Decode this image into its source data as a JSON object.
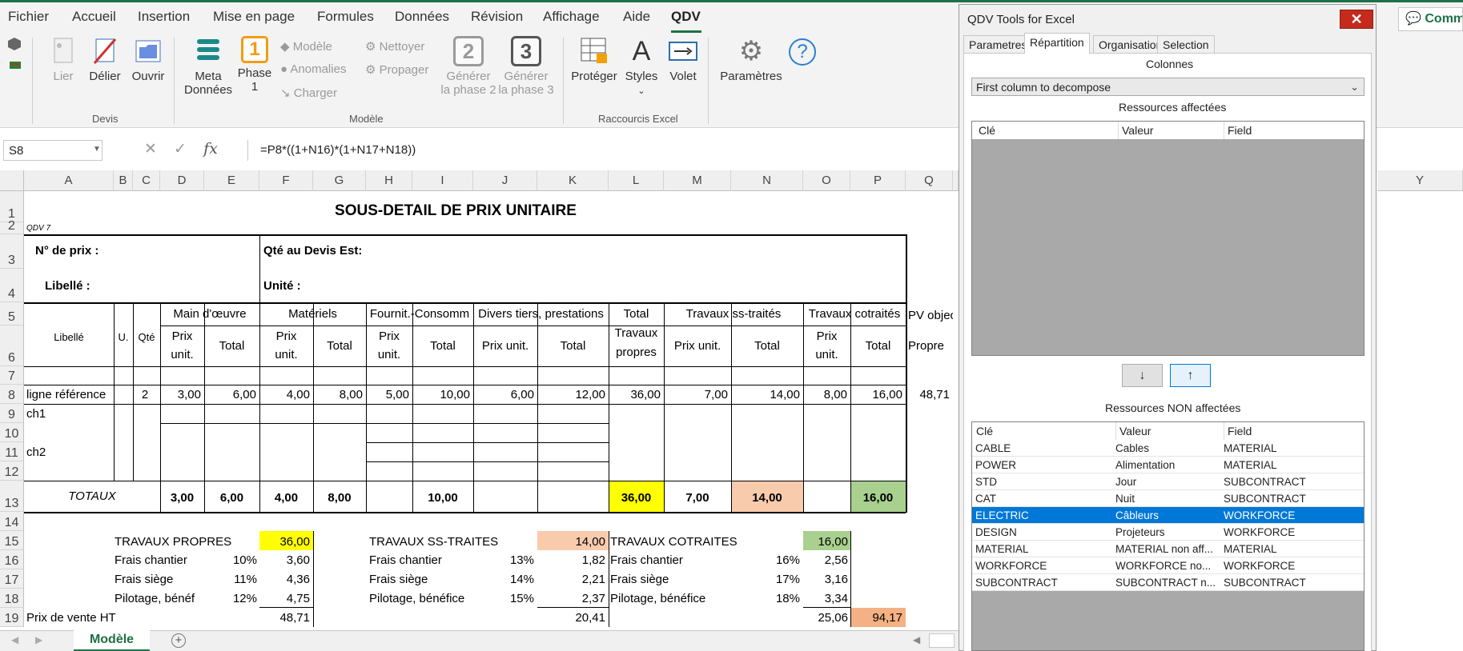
{
  "menu": [
    "Fichier",
    "Accueil",
    "Insertion",
    "Mise en page",
    "Formules",
    "Données",
    "Révision",
    "Affichage",
    "Aide",
    "QDV"
  ],
  "ribbon": {
    "devis": {
      "lier": "Lier",
      "delier": "Délier",
      "ouvrir": "Ouvrir",
      "group": "Devis"
    },
    "modele": {
      "meta1": "Meta",
      "meta2": "Données",
      "phase1": "Phase",
      "phase1b": "1",
      "phase1_num": "1",
      "small_modele": "Modèle",
      "small_anomalies": "Anomalies",
      "small_charger": "Charger",
      "small_nettoyer": "Nettoyer",
      "small_propager": "Propager",
      "gen2a": "Générer",
      "gen2b": "la phase 2",
      "gen2_num": "2",
      "gen3a": "Générer",
      "gen3b": "la phase 3",
      "gen3_num": "3",
      "group": "Modèle"
    },
    "raccourcis": {
      "proteger": "Protéger",
      "styles": "Styles",
      "volet": "Volet",
      "group": "Raccourcis Excel"
    },
    "parametres": "Paramètres",
    "help": "?",
    "comm": "Comm"
  },
  "namebox": "S8",
  "formula": "=P8*((1+N16)*(1+N17+N18))",
  "colors": {
    "yellow": "#ffff00",
    "peach": "#f8cbad",
    "green": "#a9d08e",
    "orange": "#f4b183",
    "select": "#0078d7",
    "excel_green": "#1e7145"
  },
  "columns": [
    "A",
    "B",
    "C",
    "D",
    "E",
    "F",
    "G",
    "H",
    "I",
    "J",
    "K",
    "L",
    "M",
    "N",
    "O",
    "P",
    "Q",
    "Y"
  ],
  "rows": [
    "1",
    "2",
    "3",
    "4",
    "5",
    "6",
    "7",
    "8",
    "9",
    "10",
    "11",
    "12",
    "13",
    "14",
    "15",
    "16",
    "17",
    "18",
    "19"
  ],
  "sheet": {
    "title": "SOUS-DETAIL DE PRIX UNITAIRE",
    "qdv": "QDV 7",
    "num_prix": "N° de prix :",
    "qte_devis": "Qté au Devis Est:",
    "libelle_lbl": "Libellé :",
    "unite": "Unité :",
    "h_libelle": "Libellé",
    "h_u": "U.",
    "h_qte": "Qté",
    "h_main": "Main d'œuvre",
    "h_mat": "Matériels",
    "h_fourn": "Fournit.-Consomm",
    "h_divers": "Divers tiers, prestations",
    "h_total1": "Total",
    "h_total2": "Travaux",
    "h_total3": "propres",
    "h_trav_ss": "Travaux ss-traités",
    "h_trav_co": "Travaux cotraités",
    "h_pv": "PV objec",
    "prix": "Prix",
    "unit": "unit.",
    "total": "Total",
    "prix_unit": "Prix unit.",
    "propre": "Propre",
    "row8": [
      "ligne référence",
      "2",
      "3,00",
      "6,00",
      "4,00",
      "8,00",
      "5,00",
      "10,00",
      "6,00",
      "12,00",
      "36,00",
      "7,00",
      "14,00",
      "8,00",
      "16,00",
      "48,71"
    ],
    "ch1": "ch1",
    "ch2": "ch2",
    "totaux": "TOTAUX",
    "row13": [
      "3,00",
      "6,00",
      "4,00",
      "8,00",
      "10,00",
      "36,00",
      "7,00",
      "14,00",
      "16,00"
    ],
    "tp": "TRAVAUX PROPRES",
    "tp_val": "36,00",
    "ts": "TRAVAUX SS-TRAITES",
    "ts_val": "14,00",
    "tc": "TRAVAUX COTRAITES",
    "tc_val": "16,00",
    "frais_chantier": "Frais chantier",
    "frais_siege": "Frais siège",
    "pilotage1": "Pilotage, bénéf",
    "pilotage2": "Pilotage, bénéfice",
    "r16": [
      "10%",
      "3,60",
      "13%",
      "1,82",
      "16%",
      "2,56"
    ],
    "r17": [
      "11%",
      "4,36",
      "14%",
      "2,21",
      "17%",
      "3,16"
    ],
    "r18": [
      "12%",
      "4,75",
      "15%",
      "2,37",
      "18%",
      "3,34"
    ],
    "pv_ht": "Prix de vente HT",
    "r19": [
      "48,71",
      "20,41",
      "25,06",
      "94,17"
    ]
  },
  "tab_name": "Modèle",
  "dialog": {
    "title": "QDV Tools for Excel",
    "tabs": [
      "Parametres",
      "Répartition",
      "Organisation",
      "Selection"
    ],
    "colonnes": "Colonnes",
    "combo": "First column to decompose",
    "affectees": "Ressources affectées",
    "non_affectees": "Ressources NON affectées",
    "headers": [
      "Clé",
      "Valeur",
      "Field"
    ],
    "down": "↓",
    "up": "↑",
    "items": [
      [
        "CABLE",
        "Cables",
        "MATERIAL"
      ],
      [
        "POWER",
        "Alimentation",
        "MATERIAL"
      ],
      [
        "STD",
        "Jour",
        "SUBCONTRACT"
      ],
      [
        "CAT",
        "Nuit",
        "SUBCONTRACT"
      ],
      [
        "ELECTRIC",
        "Câbleurs",
        "WORKFORCE"
      ],
      [
        "DESIGN",
        "Projeteurs",
        "WORKFORCE"
      ],
      [
        "MATERIAL",
        "MATERIAL non aff...",
        "MATERIAL"
      ],
      [
        "WORKFORCE",
        "WORKFORCE no...",
        "WORKFORCE"
      ],
      [
        "SUBCONTRACT",
        "SUBCONTRACT n...",
        "SUBCONTRACT"
      ]
    ]
  }
}
